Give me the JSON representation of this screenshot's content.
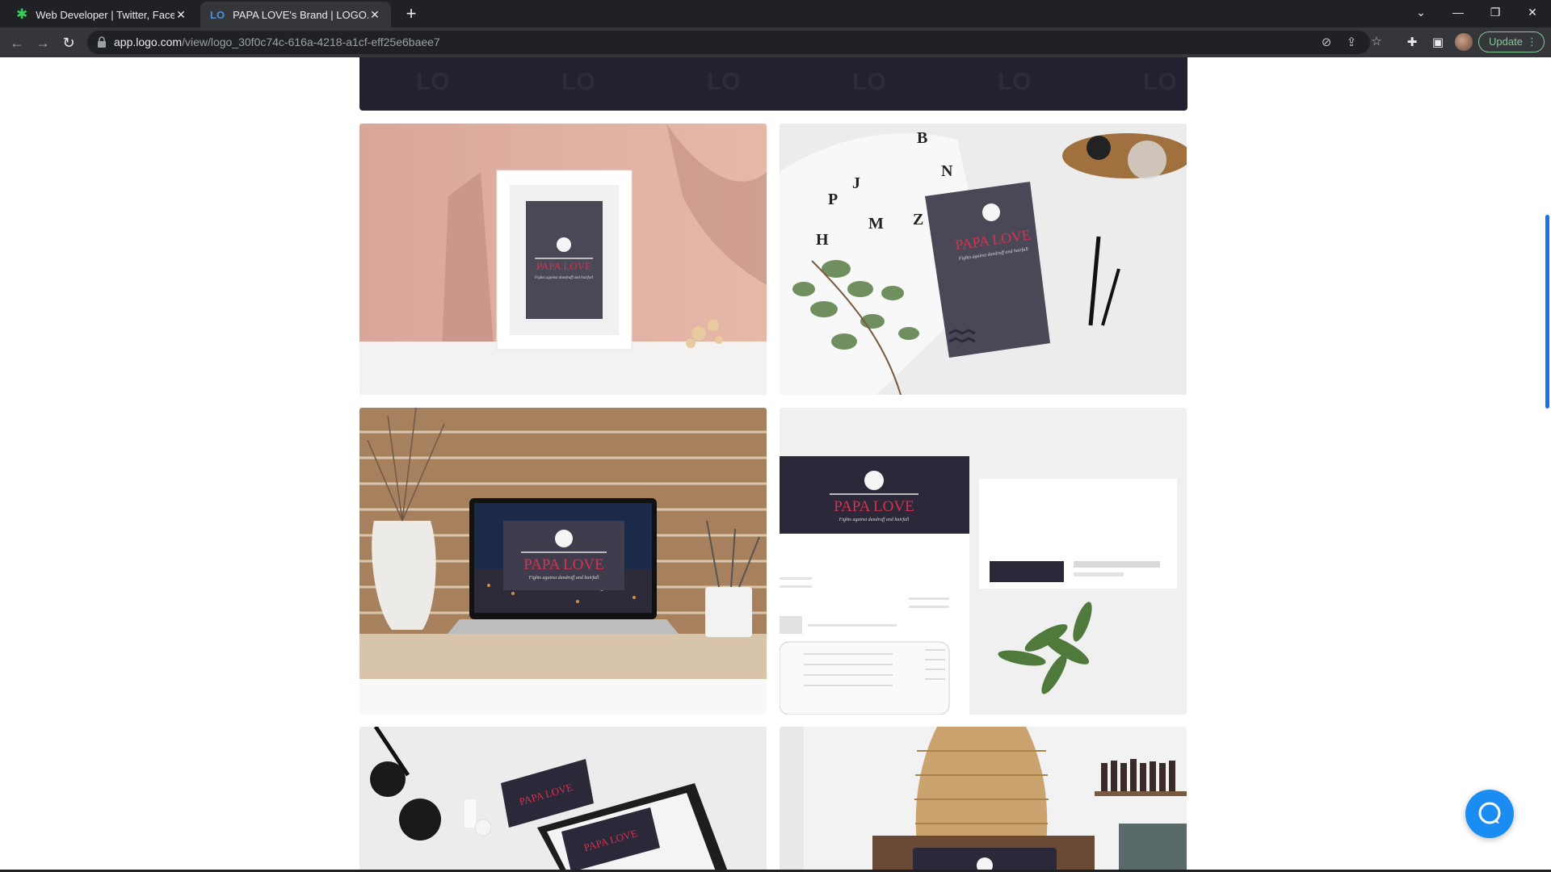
{
  "browser": {
    "tabs": [
      {
        "title": "Web Developer | Twitter, Faceboo",
        "active": false,
        "favicon": "green-asterisk-icon"
      },
      {
        "title": "PAPA LOVE's Brand | LOGO.com",
        "active": true,
        "favicon": "logo-com-icon"
      }
    ],
    "url_host": "app.logo.com",
    "url_path": "/view/logo_30f0c74c-616a-4218-a1cf-eff25e6baee7",
    "update_label": "Update",
    "accent": "#81c995"
  },
  "brand": {
    "name": "PAPA LOVE",
    "tagline": "Fights against dandruff and hairfall",
    "primary_color": "#2a2839",
    "accent_color": "#d6324e"
  },
  "mockups": [
    {
      "label": "Photo frame mockup"
    },
    {
      "label": "Notebook mockup"
    },
    {
      "label": "Laptop mockup"
    },
    {
      "label": "Stationery mockup"
    },
    {
      "label": "Clipboard mockup"
    },
    {
      "label": "Lamp sign mockup"
    }
  ],
  "chat": {
    "icon": "chat-bubble-icon",
    "color": "#1b8cf2"
  }
}
